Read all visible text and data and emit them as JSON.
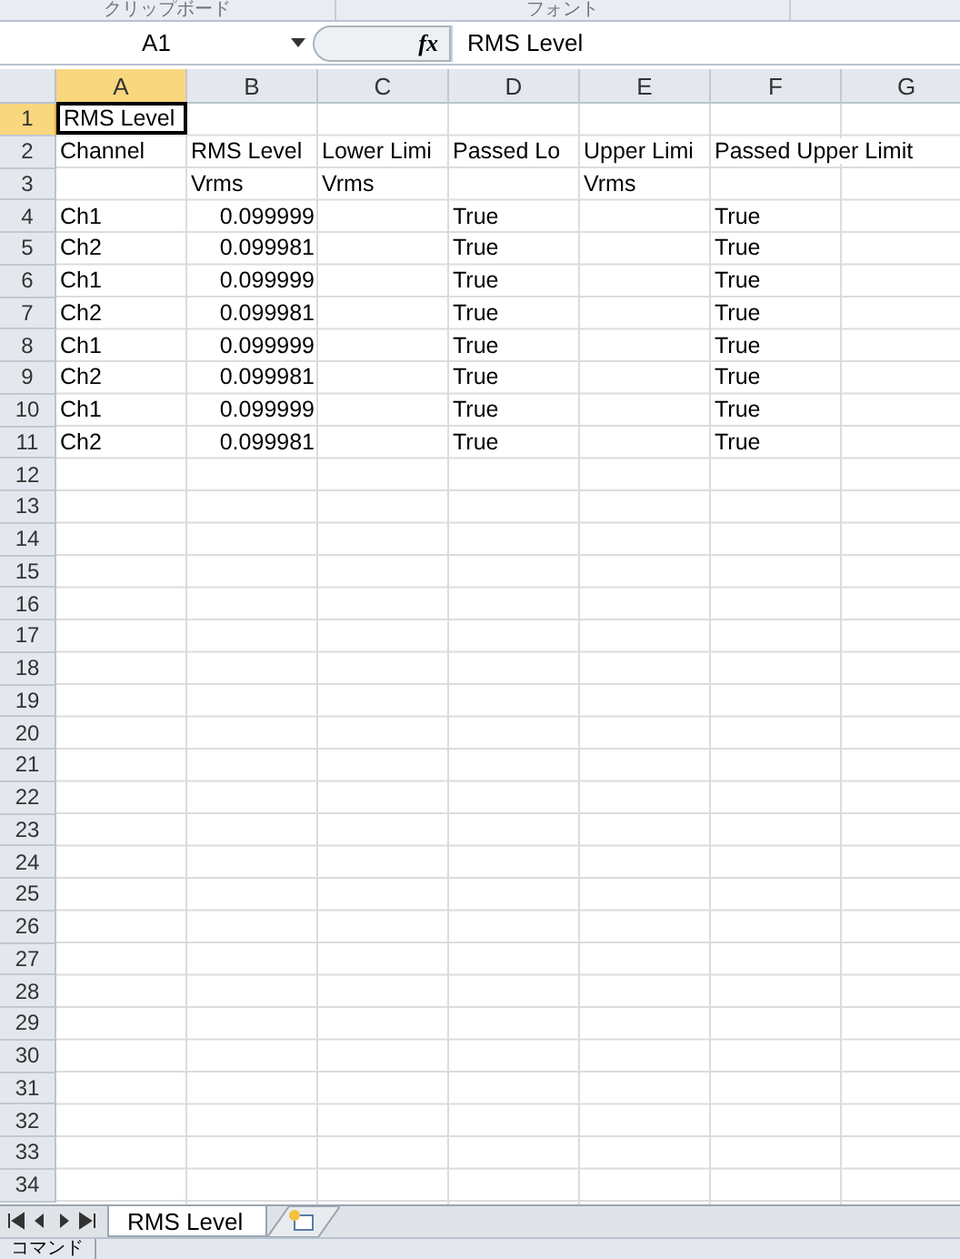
{
  "ribbon_groups": [
    {
      "label": "クリップボード"
    },
    {
      "label": "フォント"
    }
  ],
  "name_box": "A1",
  "formula_bar": {
    "fx": "fx",
    "value": "RMS Level"
  },
  "columns": [
    {
      "label": "A",
      "selected": true
    },
    {
      "label": "B",
      "selected": false
    },
    {
      "label": "C",
      "selected": false
    },
    {
      "label": "D",
      "selected": false
    },
    {
      "label": "E",
      "selected": false
    },
    {
      "label": "F",
      "selected": false
    },
    {
      "label": "G",
      "selected": false
    }
  ],
  "rows": [
    {
      "header": "1",
      "selected": true,
      "cells": [
        {
          "text": "RMS Level"
        }
      ]
    },
    {
      "header": "2",
      "selected": false,
      "cells": [
        {
          "text": "Channel"
        },
        {
          "text": "RMS Level"
        },
        {
          "text": "Lower Limi"
        },
        {
          "text": "Passed Lo"
        },
        {
          "text": "Upper Limi"
        },
        {
          "text": "Passed Upper Limit"
        }
      ]
    },
    {
      "header": "3",
      "selected": false,
      "cells": [
        null,
        {
          "text": "Vrms"
        },
        {
          "text": "Vrms"
        },
        null,
        {
          "text": "Vrms"
        }
      ]
    },
    {
      "header": "4",
      "selected": false,
      "cells": [
        {
          "text": "Ch1"
        },
        {
          "text": "0.099999",
          "numeric": true
        },
        null,
        {
          "text": "True"
        },
        null,
        {
          "text": "True"
        }
      ]
    },
    {
      "header": "5",
      "selected": false,
      "cells": [
        {
          "text": "Ch2"
        },
        {
          "text": "0.099981",
          "numeric": true
        },
        null,
        {
          "text": "True"
        },
        null,
        {
          "text": "True"
        }
      ]
    },
    {
      "header": "6",
      "selected": false,
      "cells": [
        {
          "text": "Ch1"
        },
        {
          "text": "0.099999",
          "numeric": true
        },
        null,
        {
          "text": "True"
        },
        null,
        {
          "text": "True"
        }
      ]
    },
    {
      "header": "7",
      "selected": false,
      "cells": [
        {
          "text": "Ch2"
        },
        {
          "text": "0.099981",
          "numeric": true
        },
        null,
        {
          "text": "True"
        },
        null,
        {
          "text": "True"
        }
      ]
    },
    {
      "header": "8",
      "selected": false,
      "cells": [
        {
          "text": "Ch1"
        },
        {
          "text": "0.099999",
          "numeric": true
        },
        null,
        {
          "text": "True"
        },
        null,
        {
          "text": "True"
        }
      ]
    },
    {
      "header": "9",
      "selected": false,
      "cells": [
        {
          "text": "Ch2"
        },
        {
          "text": "0.099981",
          "numeric": true
        },
        null,
        {
          "text": "True"
        },
        null,
        {
          "text": "True"
        }
      ]
    },
    {
      "header": "10",
      "selected": false,
      "cells": [
        {
          "text": "Ch1"
        },
        {
          "text": "0.099999",
          "numeric": true
        },
        null,
        {
          "text": "True"
        },
        null,
        {
          "text": "True"
        }
      ]
    },
    {
      "header": "11",
      "selected": false,
      "cells": [
        {
          "text": "Ch2"
        },
        {
          "text": "0.099981",
          "numeric": true
        },
        null,
        {
          "text": "True"
        },
        null,
        {
          "text": "True"
        }
      ]
    },
    {
      "header": "12",
      "selected": false
    },
    {
      "header": "13",
      "selected": false
    },
    {
      "header": "14",
      "selected": false
    },
    {
      "header": "15",
      "selected": false
    },
    {
      "header": "16",
      "selected": false
    },
    {
      "header": "17",
      "selected": false
    },
    {
      "header": "18",
      "selected": false
    },
    {
      "header": "19",
      "selected": false
    },
    {
      "header": "20",
      "selected": false
    },
    {
      "header": "21",
      "selected": false
    },
    {
      "header": "22",
      "selected": false
    },
    {
      "header": "23",
      "selected": false
    },
    {
      "header": "24",
      "selected": false
    },
    {
      "header": "25",
      "selected": false
    },
    {
      "header": "26",
      "selected": false
    },
    {
      "header": "27",
      "selected": false
    },
    {
      "header": "28",
      "selected": false
    },
    {
      "header": "29",
      "selected": false
    },
    {
      "header": "30",
      "selected": false
    },
    {
      "header": "31",
      "selected": false
    },
    {
      "header": "32",
      "selected": false
    },
    {
      "header": "33",
      "selected": false
    },
    {
      "header": "34",
      "selected": false
    }
  ],
  "sheet_tabs": [
    {
      "label": "RMS Level",
      "selected": true
    }
  ],
  "status_bar": "コマンド"
}
